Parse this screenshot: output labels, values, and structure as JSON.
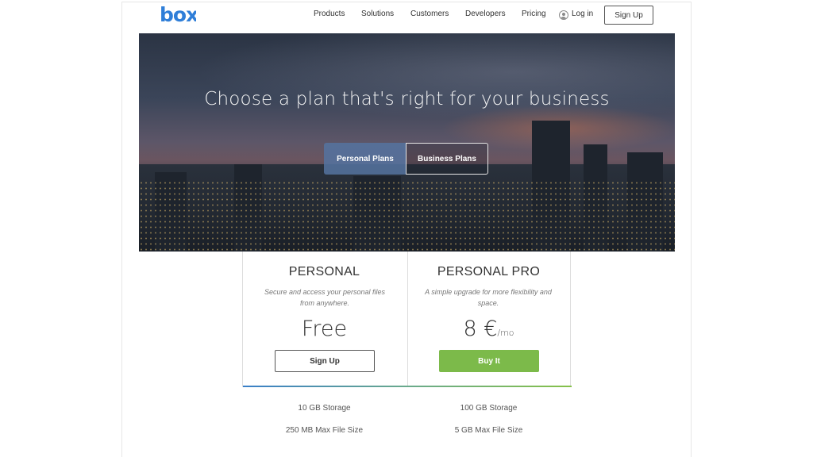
{
  "brand": {
    "logo_text": "box",
    "logo_color": "#2f7ed8"
  },
  "nav": {
    "items": [
      "Products",
      "Solutions",
      "Customers",
      "Developers",
      "Pricing"
    ],
    "login_label": "Log in",
    "signup_label": "Sign Up"
  },
  "hero": {
    "title": "Choose a plan that's right for your business",
    "toggle": [
      "Personal Plans",
      "Business Plans"
    ],
    "active_toggle": "Personal Plans"
  },
  "plans": [
    {
      "name": "PERSONAL",
      "description": "Secure and access your personal files from anywhere.",
      "price": "Free",
      "price_unit": "",
      "cta": "Sign Up",
      "features": [
        "10 GB Storage",
        "250 MB Max File Size"
      ]
    },
    {
      "name": "PERSONAL PRO",
      "description": "A simple upgrade for more flexibility and space.",
      "price": "8 €",
      "price_unit": "/mo",
      "cta": "Buy It",
      "features": [
        "100 GB Storage",
        "5 GB Max File Size"
      ]
    }
  ],
  "colors": {
    "accent_green": "#7cba4a",
    "accent_blue": "#2f7ed8"
  }
}
